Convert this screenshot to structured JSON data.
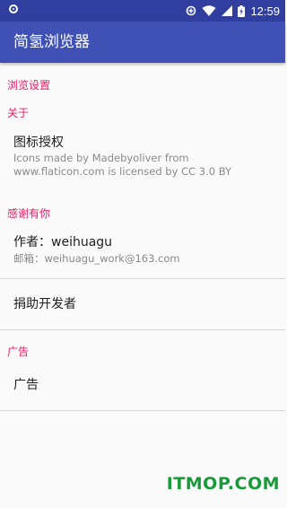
{
  "status_bar": {
    "time": "12:59",
    "icons": [
      "notification-icon",
      "data-saver-icon",
      "wifi-icon",
      "signal-icon",
      "battery-charging-icon"
    ]
  },
  "app_bar": {
    "title": "简氢浏览器"
  },
  "categories": {
    "browse_settings": "浏览设置",
    "about": "关于",
    "thanks": "感谢有你",
    "ads": "广告"
  },
  "prefs": {
    "icon_license": {
      "title": "图标授权",
      "summary": "Icons made by Madebyoliver from www.flaticon.com is licensed by CC 3.0 BY"
    },
    "author": {
      "title": "作者：weihuagu",
      "summary": "邮箱：weihuagu_work@163.com"
    },
    "donate": {
      "title": "捐助开发者"
    },
    "ad": {
      "title": "广告"
    }
  },
  "watermark": "ITMOP.COM",
  "colors": {
    "primary": "#3f51b5",
    "primary_dark": "#303f9f",
    "accent": "#e91e63",
    "watermark": "#199a3a"
  }
}
